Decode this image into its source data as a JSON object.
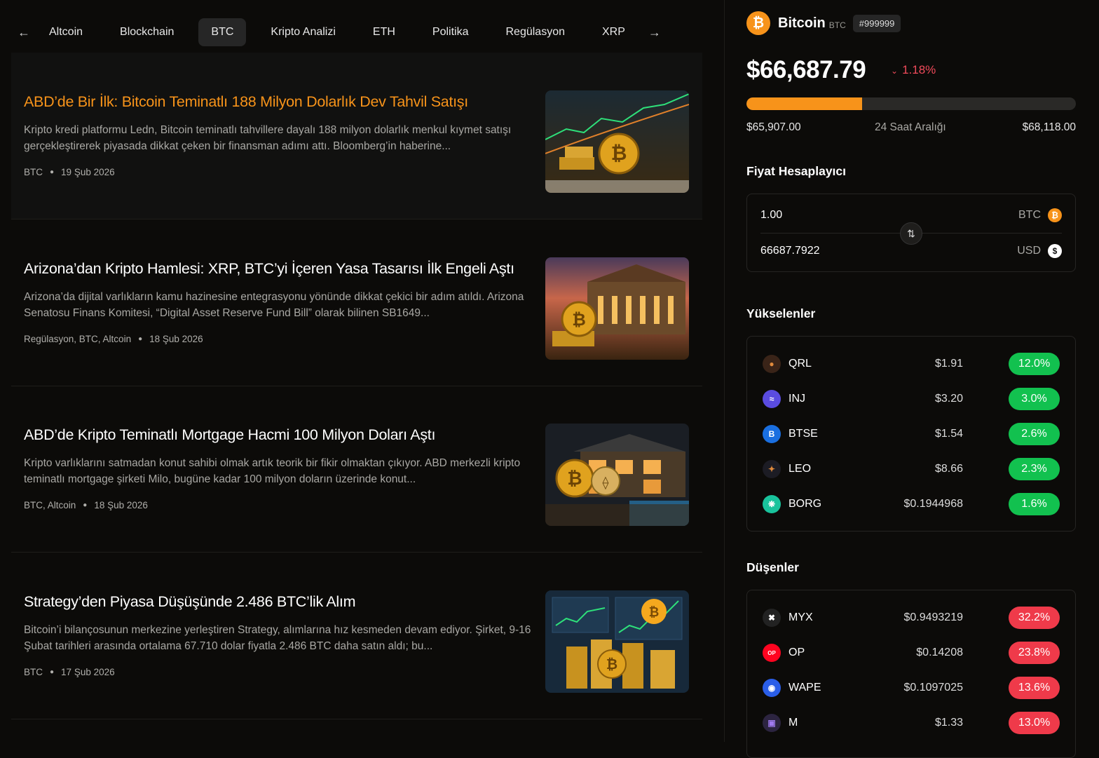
{
  "tabs": [
    "Altcoin",
    "Blockchain",
    "BTC",
    "Kripto Analizi",
    "ETH",
    "Politika",
    "Regülasyon",
    "XRP"
  ],
  "active_tab": "BTC",
  "articles": [
    {
      "title": "ABD’de Bir İlk: Bitcoin Teminatlı 188 Milyon Dolarlık Dev Tahvil Satışı",
      "summary": "Kripto kredi platformu Ledn, Bitcoin teminatlı tahvillere dayalı 188 milyon dolarlık menkul kıymet satışı gerçekleştirerek piyasada dikkat çeken bir finansman adımı attı. Bloomberg’in haberine...",
      "tags": "BTC",
      "date": "19 Şub 2026"
    },
    {
      "title": "Arizona’dan Kripto Hamlesi: XRP, BTC’yi İçeren Yasa Tasarısı İlk Engeli Aştı",
      "summary": "Arizona’da dijital varlıkların kamu hazinesine entegrasyonu yönünde dikkat çekici bir adım atıldı. Arizona Senatosu Finans Komitesi, “Digital Asset Reserve Fund Bill” olarak bilinen SB1649...",
      "tags": "Regülasyon, BTC, Altcoin",
      "date": "18 Şub 2026"
    },
    {
      "title": "ABD’de Kripto Teminatlı Mortgage Hacmi 100 Milyon Doları Aştı",
      "summary": "Kripto varlıklarını satmadan konut sahibi olmak artık teorik bir fikir olmaktan çıkıyor. ABD merkezli kripto teminatlı mortgage şirketi Milo, bugüne kadar 100 milyon doların üzerinde konut...",
      "tags": "BTC, Altcoin",
      "date": "18 Şub 2026"
    },
    {
      "title": "Strategy’den Piyasa Düşüşünde 2.486 BTC’lik Alım",
      "summary": "Bitcoin’i bilançosunun merkezine yerleştiren Strategy, alımlarına hız kesmeden devam ediyor. Şirket, 9-16 Şubat tarihleri arasında ortalama 67.710 dolar fiyatla 2.486 BTC daha satın aldı; bu...",
      "tags": "BTC",
      "date": "17 Şub 2026"
    }
  ],
  "coin": {
    "name": "Bitcoin",
    "symbol": "BTC",
    "rank": "#999999",
    "price": "$66,687.79",
    "change": "1.18%",
    "range_low": "$65,907.00",
    "range_label": "24 Saat Aralığı",
    "range_high": "$68,118.00",
    "range_position": 0.35
  },
  "calculator": {
    "title": "Fiyat Hesaplayıcı",
    "amount": "1.00",
    "amount_currency": "BTC",
    "result": "66687.7922",
    "result_currency": "USD"
  },
  "gainers": {
    "title": "Yükselenler",
    "items": [
      {
        "symbol": "QRL",
        "price": "$1.91",
        "change": "12.0%",
        "color": "#e08a3c"
      },
      {
        "symbol": "INJ",
        "price": "$3.20",
        "change": "3.0%",
        "color": "#5a4ce0"
      },
      {
        "symbol": "BTSE",
        "price": "$1.54",
        "change": "2.6%",
        "color": "#1a6fe0"
      },
      {
        "symbol": "LEO",
        "price": "$8.66",
        "change": "2.3%",
        "color": "#2a2a2a"
      },
      {
        "symbol": "BORG",
        "price": "$0.1944968",
        "change": "1.6%",
        "color": "#19c39c"
      }
    ]
  },
  "losers": {
    "title": "Düşenler",
    "items": [
      {
        "symbol": "MYX",
        "price": "$0.9493219",
        "change": "32.2%",
        "color": "#222"
      },
      {
        "symbol": "OP",
        "price": "$0.14208",
        "change": "23.8%",
        "color": "#ff0420"
      },
      {
        "symbol": "WAPE",
        "price": "$0.1097025",
        "change": "13.6%",
        "color": "#2a5ee8"
      },
      {
        "symbol": "M",
        "price": "$1.33",
        "change": "13.0%",
        "color": "#2c2440"
      }
    ]
  }
}
